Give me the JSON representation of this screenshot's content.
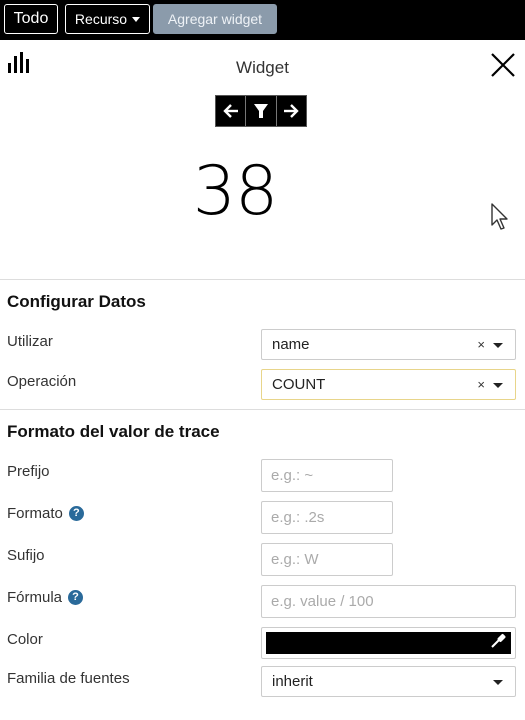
{
  "toolbar": {
    "all_label": "Todo",
    "resource_label": "Recurso",
    "add_widget_label": "Agregar widget"
  },
  "widget": {
    "title": "Widget",
    "value": "38",
    "icons": [
      "bar-chart-icon",
      "close-icon",
      "arrow-left-icon",
      "filter-icon",
      "arrow-right-icon",
      "cursor-icon"
    ]
  },
  "config": {
    "section_title": "Configurar Datos",
    "use_label": "Utilizar",
    "use_value": "name",
    "operation_label": "Operación",
    "operation_value": "COUNT",
    "clear_glyph": "×"
  },
  "format": {
    "section_title": "Formato del valor de trace",
    "prefix_label": "Prefijo",
    "prefix_placeholder": "e.g.: ~",
    "format_label": "Formato",
    "format_placeholder": "e.g.: .2s",
    "suffix_label": "Sufijo",
    "suffix_placeholder": "e.g.: W",
    "formula_label": "Fórmula",
    "formula_placeholder": "e.g. value / 100",
    "color_label": "Color",
    "color_value": "#000000",
    "font_family_label": "Familia de fuentes",
    "font_family_value": "inherit",
    "help_glyph": "?"
  }
}
